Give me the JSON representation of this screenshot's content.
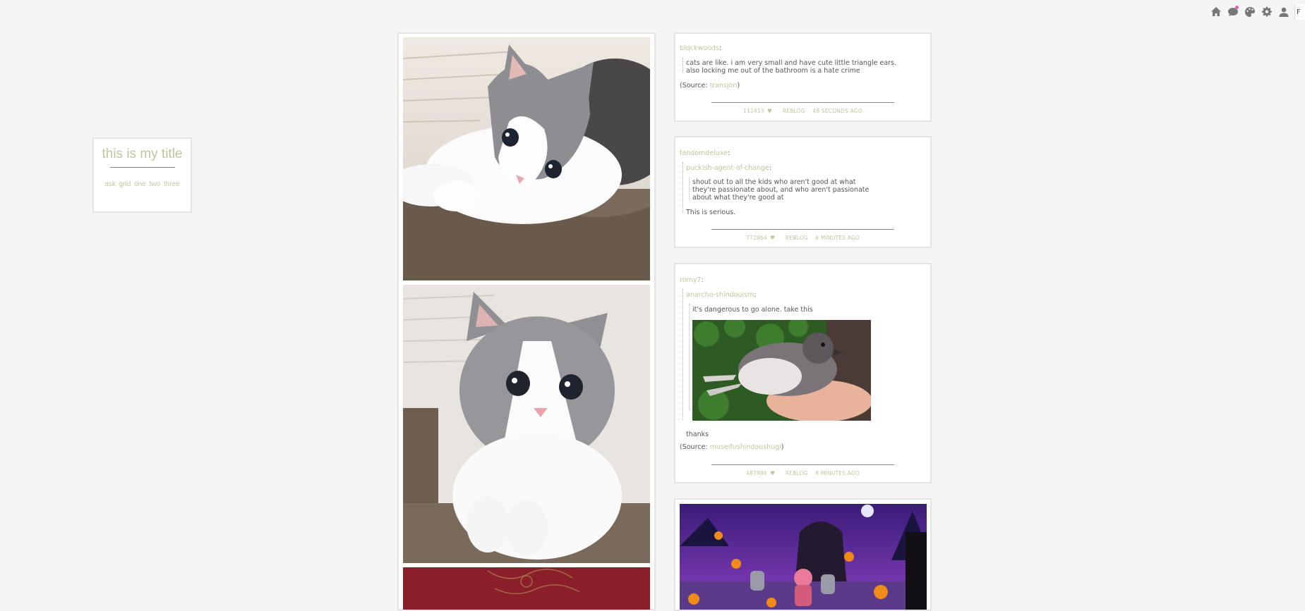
{
  "topbar": {
    "icons": [
      "home-icon",
      "chat-icon",
      "palette-icon",
      "gear-icon",
      "user-icon"
    ],
    "edge_label": "F"
  },
  "sidebar": {
    "title": "this is my title",
    "links": [
      "ask",
      "grid",
      "one",
      "two",
      "three"
    ]
  },
  "posts": [
    {
      "user": "blqckwoods",
      "quote": [
        "cats are like. i am very small and have cute little triangle ears.",
        "also locking me out of the bathroom is a hate crime"
      ],
      "source_label": "(Source: ",
      "source_link": "transjon",
      "source_end": ")",
      "notes": "112413",
      "reblog": "REBLOG",
      "time": "48 SECONDS AGO"
    },
    {
      "user": "fandomdeluxe",
      "inner_user": "puckish-agent-of-change",
      "quote": [
        "shout out to all the kids who aren't good at what",
        "they're passionate about, and who aren't passionate",
        "about what they're good at"
      ],
      "comment": "This is serious.",
      "notes": "772964",
      "reblog": "REBLOG",
      "time": "6 MINUTES AGO"
    },
    {
      "user": "romy7",
      "inner_user": "anarcho-shindouism",
      "quote": [
        "it's dangerous to go alone. take this"
      ],
      "comment": "thanks",
      "source_label": "(Source: ",
      "source_link": "museifushindoushugi",
      "source_end": ")",
      "notes": "487986",
      "reblog": "REBLOG",
      "time": "8 MINUTES AGO"
    }
  ],
  "colors": {
    "accent": "#c3c49e",
    "background": "#f5f5f5",
    "card": "#ffffff",
    "border": "#e4e4e4"
  }
}
